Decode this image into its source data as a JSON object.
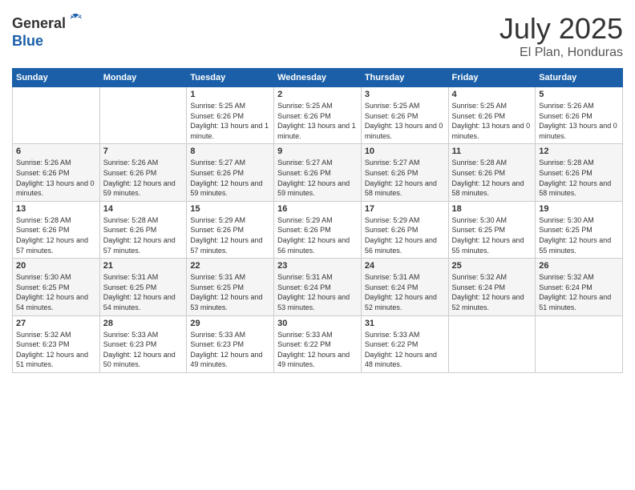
{
  "header": {
    "logo_line1": "General",
    "logo_line2": "Blue",
    "month": "July 2025",
    "location": "El Plan, Honduras"
  },
  "weekdays": [
    "Sunday",
    "Monday",
    "Tuesday",
    "Wednesday",
    "Thursday",
    "Friday",
    "Saturday"
  ],
  "weeks": [
    [
      {
        "day": "",
        "info": ""
      },
      {
        "day": "",
        "info": ""
      },
      {
        "day": "1",
        "info": "Sunrise: 5:25 AM\nSunset: 6:26 PM\nDaylight: 13 hours and 1 minute."
      },
      {
        "day": "2",
        "info": "Sunrise: 5:25 AM\nSunset: 6:26 PM\nDaylight: 13 hours and 1 minute."
      },
      {
        "day": "3",
        "info": "Sunrise: 5:25 AM\nSunset: 6:26 PM\nDaylight: 13 hours and 0 minutes."
      },
      {
        "day": "4",
        "info": "Sunrise: 5:25 AM\nSunset: 6:26 PM\nDaylight: 13 hours and 0 minutes."
      },
      {
        "day": "5",
        "info": "Sunrise: 5:26 AM\nSunset: 6:26 PM\nDaylight: 13 hours and 0 minutes."
      }
    ],
    [
      {
        "day": "6",
        "info": "Sunrise: 5:26 AM\nSunset: 6:26 PM\nDaylight: 13 hours and 0 minutes."
      },
      {
        "day": "7",
        "info": "Sunrise: 5:26 AM\nSunset: 6:26 PM\nDaylight: 12 hours and 59 minutes."
      },
      {
        "day": "8",
        "info": "Sunrise: 5:27 AM\nSunset: 6:26 PM\nDaylight: 12 hours and 59 minutes."
      },
      {
        "day": "9",
        "info": "Sunrise: 5:27 AM\nSunset: 6:26 PM\nDaylight: 12 hours and 59 minutes."
      },
      {
        "day": "10",
        "info": "Sunrise: 5:27 AM\nSunset: 6:26 PM\nDaylight: 12 hours and 58 minutes."
      },
      {
        "day": "11",
        "info": "Sunrise: 5:28 AM\nSunset: 6:26 PM\nDaylight: 12 hours and 58 minutes."
      },
      {
        "day": "12",
        "info": "Sunrise: 5:28 AM\nSunset: 6:26 PM\nDaylight: 12 hours and 58 minutes."
      }
    ],
    [
      {
        "day": "13",
        "info": "Sunrise: 5:28 AM\nSunset: 6:26 PM\nDaylight: 12 hours and 57 minutes."
      },
      {
        "day": "14",
        "info": "Sunrise: 5:28 AM\nSunset: 6:26 PM\nDaylight: 12 hours and 57 minutes."
      },
      {
        "day": "15",
        "info": "Sunrise: 5:29 AM\nSunset: 6:26 PM\nDaylight: 12 hours and 57 minutes."
      },
      {
        "day": "16",
        "info": "Sunrise: 5:29 AM\nSunset: 6:26 PM\nDaylight: 12 hours and 56 minutes."
      },
      {
        "day": "17",
        "info": "Sunrise: 5:29 AM\nSunset: 6:26 PM\nDaylight: 12 hours and 56 minutes."
      },
      {
        "day": "18",
        "info": "Sunrise: 5:30 AM\nSunset: 6:25 PM\nDaylight: 12 hours and 55 minutes."
      },
      {
        "day": "19",
        "info": "Sunrise: 5:30 AM\nSunset: 6:25 PM\nDaylight: 12 hours and 55 minutes."
      }
    ],
    [
      {
        "day": "20",
        "info": "Sunrise: 5:30 AM\nSunset: 6:25 PM\nDaylight: 12 hours and 54 minutes."
      },
      {
        "day": "21",
        "info": "Sunrise: 5:31 AM\nSunset: 6:25 PM\nDaylight: 12 hours and 54 minutes."
      },
      {
        "day": "22",
        "info": "Sunrise: 5:31 AM\nSunset: 6:25 PM\nDaylight: 12 hours and 53 minutes."
      },
      {
        "day": "23",
        "info": "Sunrise: 5:31 AM\nSunset: 6:24 PM\nDaylight: 12 hours and 53 minutes."
      },
      {
        "day": "24",
        "info": "Sunrise: 5:31 AM\nSunset: 6:24 PM\nDaylight: 12 hours and 52 minutes."
      },
      {
        "day": "25",
        "info": "Sunrise: 5:32 AM\nSunset: 6:24 PM\nDaylight: 12 hours and 52 minutes."
      },
      {
        "day": "26",
        "info": "Sunrise: 5:32 AM\nSunset: 6:24 PM\nDaylight: 12 hours and 51 minutes."
      }
    ],
    [
      {
        "day": "27",
        "info": "Sunrise: 5:32 AM\nSunset: 6:23 PM\nDaylight: 12 hours and 51 minutes."
      },
      {
        "day": "28",
        "info": "Sunrise: 5:33 AM\nSunset: 6:23 PM\nDaylight: 12 hours and 50 minutes."
      },
      {
        "day": "29",
        "info": "Sunrise: 5:33 AM\nSunset: 6:23 PM\nDaylight: 12 hours and 49 minutes."
      },
      {
        "day": "30",
        "info": "Sunrise: 5:33 AM\nSunset: 6:22 PM\nDaylight: 12 hours and 49 minutes."
      },
      {
        "day": "31",
        "info": "Sunrise: 5:33 AM\nSunset: 6:22 PM\nDaylight: 12 hours and 48 minutes."
      },
      {
        "day": "",
        "info": ""
      },
      {
        "day": "",
        "info": ""
      }
    ]
  ]
}
